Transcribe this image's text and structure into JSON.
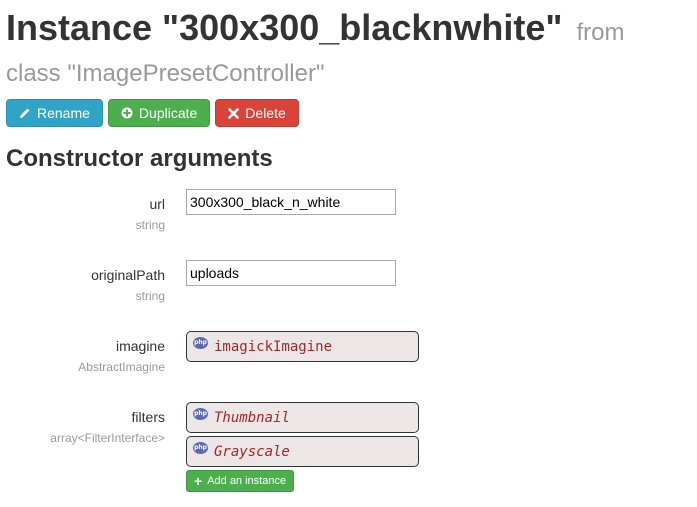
{
  "header": {
    "title": "Instance \"300x300_blacknwhite\"",
    "from": "from",
    "class_line": "class \"ImagePresetController\""
  },
  "toolbar": {
    "rename_label": "Rename",
    "duplicate_label": "Duplicate",
    "delete_label": "Delete"
  },
  "section_title": "Constructor arguments",
  "arguments": {
    "url": {
      "name": "url",
      "type": "string",
      "value": "300x300_black_n_white"
    },
    "originalPath": {
      "name": "originalPath",
      "type": "string",
      "value": "uploads"
    },
    "imagine": {
      "name": "imagine",
      "type": "AbstractImagine",
      "ref": "imagickImagine"
    },
    "filters": {
      "name": "filters",
      "type": "array<FilterInterface>",
      "items": [
        "Thumbnail",
        "Grayscale"
      ],
      "add_label": "Add an instance"
    }
  },
  "icons": {
    "php": "php",
    "pencil": "pencil-icon",
    "plus_circle": "plus-circle-icon",
    "x": "x-icon",
    "plus": "plus-icon"
  },
  "colors": {
    "rename": "#2fa4c7",
    "duplicate": "#4cae4c",
    "delete": "#d9443a",
    "ref_bg": "#ede6e6",
    "ref_text": "#a0282a"
  }
}
